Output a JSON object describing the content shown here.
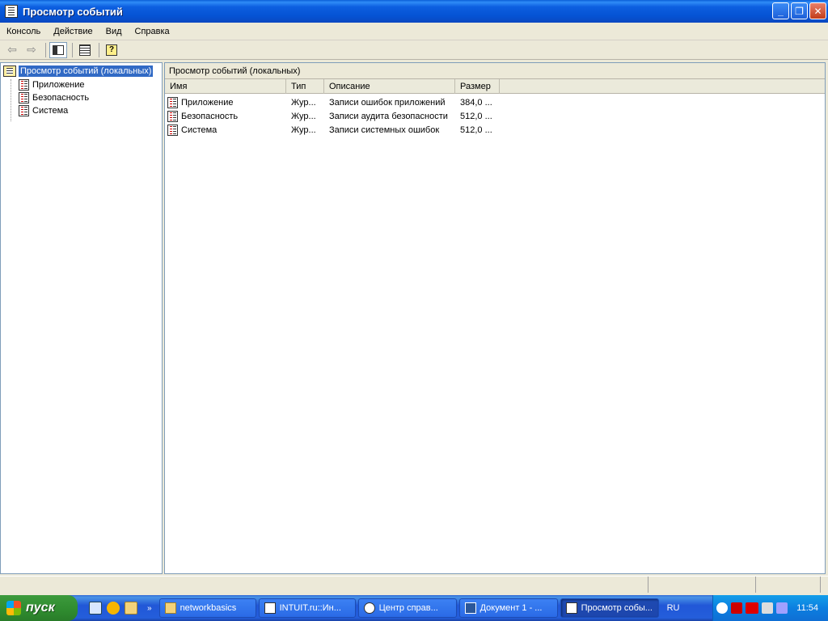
{
  "window": {
    "title": "Просмотр событий"
  },
  "menu": [
    "Консоль",
    "Действие",
    "Вид",
    "Справка"
  ],
  "tree": {
    "root": "Просмотр событий (локальных)",
    "children": [
      "Приложение",
      "Безопасность",
      "Система"
    ]
  },
  "right": {
    "header": "Просмотр событий (локальных)",
    "columns": [
      "Имя",
      "Тип",
      "Описание",
      "Размер"
    ],
    "rows": [
      {
        "name": "Приложение",
        "type": "Жур...",
        "description": "Записи ошибок приложений",
        "size": "384,0 ..."
      },
      {
        "name": "Безопасность",
        "type": "Жур...",
        "description": "Записи аудита безопасности",
        "size": "512,0 ..."
      },
      {
        "name": "Система",
        "type": "Жур...",
        "description": "Записи системных ошибок",
        "size": "512,0 ..."
      }
    ]
  },
  "taskbar": {
    "start": "пуск",
    "tasks": [
      "networkbasics",
      "INTUIT.ru::Ин...",
      "Центр справ...",
      "Документ 1 - ...",
      "Просмотр собы..."
    ],
    "lang": "RU",
    "clock": "11:54"
  }
}
